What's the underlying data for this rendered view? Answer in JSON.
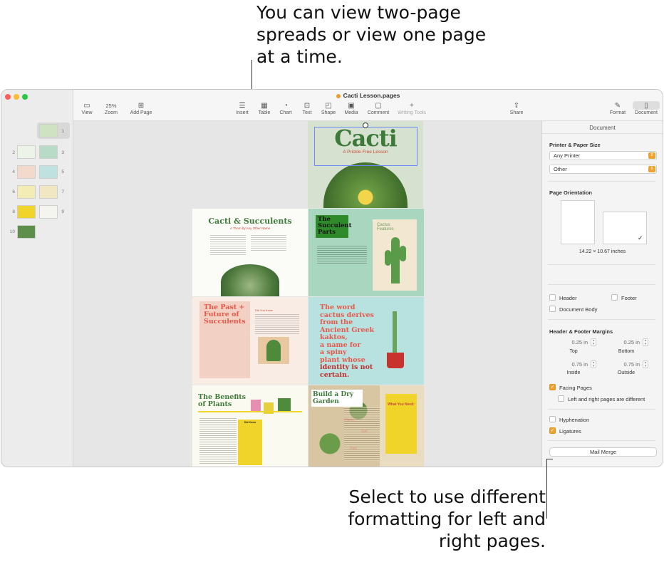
{
  "callouts": {
    "top": "You can view two-page spreads or view one page at a time.",
    "bottom": "Select to use different formatting for left and right pages."
  },
  "window": {
    "title": "Cacti Lesson.pages"
  },
  "toolbar": {
    "view": "View",
    "zoom_value": "25%",
    "zoom": "Zoom",
    "add_page": "Add Page",
    "insert": "Insert",
    "table": "Table",
    "chart": "Chart",
    "text": "Text",
    "shape": "Shape",
    "media": "Media",
    "comment": "Comment",
    "writing_tools": "Writing Tools",
    "share": "Share",
    "format": "Format",
    "document": "Document"
  },
  "thumbnails": [
    "1",
    "2",
    "3",
    "4",
    "5",
    "6",
    "7",
    "8",
    "9",
    "10"
  ],
  "pages": {
    "p1": {
      "title": "Cacti",
      "subtitle": "A Prickle Free Lesson"
    },
    "p2": {
      "title": "Cacti & Succulents",
      "subtitle": "A Thorn by Any Other Name"
    },
    "p3": {
      "title": "The Succulent Parts",
      "side": "Cactus Features"
    },
    "p4": {
      "title": "The Past + Future of Succulents",
      "side": "Did You Know"
    },
    "p5": {
      "l1": "The word",
      "l2": "cactus derives",
      "l3": "from the",
      "l4": "Ancient Greek",
      "l5": "kaktos,",
      "l6": "a name for",
      "l7": "a spiny",
      "l8": "plant whose",
      "l9": "identity is not",
      "l10": "certain."
    },
    "p6": {
      "title": "The Benefits of Plants",
      "card": "Did Know"
    },
    "p7": {
      "title": "Build a Dry Garden",
      "card": "What You Need:",
      "lbl1": "Plants",
      "lbl2": "Soil",
      "lbl3": "Pots"
    }
  },
  "inspector": {
    "tab": "Document",
    "printer_paper_size": "Printer & Paper Size",
    "printer": "Any Printer",
    "paper": "Other",
    "page_orientation": "Page Orientation",
    "dimensions": "14.22 × 10.67 inches",
    "header": "Header",
    "footer": "Footer",
    "document_body": "Document Body",
    "header_footer_margins": "Header & Footer Margins",
    "top_value": "0.25 in",
    "top": "Top",
    "bottom_value": "0.25 in",
    "bottom": "Bottom",
    "inside_value": "0.75 in",
    "inside": "Inside",
    "outside_value": "0.75 in",
    "outside": "Outside",
    "facing_pages": "Facing Pages",
    "left_right_different": "Left and right pages are different",
    "hyphenation": "Hyphenation",
    "ligatures": "Ligatures",
    "mail_merge": "Mail Merge"
  },
  "colors": {
    "accent": "#f0a22e",
    "close": "#ff5f57",
    "minimize": "#febc2e",
    "zoom": "#28c840",
    "cacti_green": "#3d7a3a",
    "coral": "#e8584a"
  }
}
